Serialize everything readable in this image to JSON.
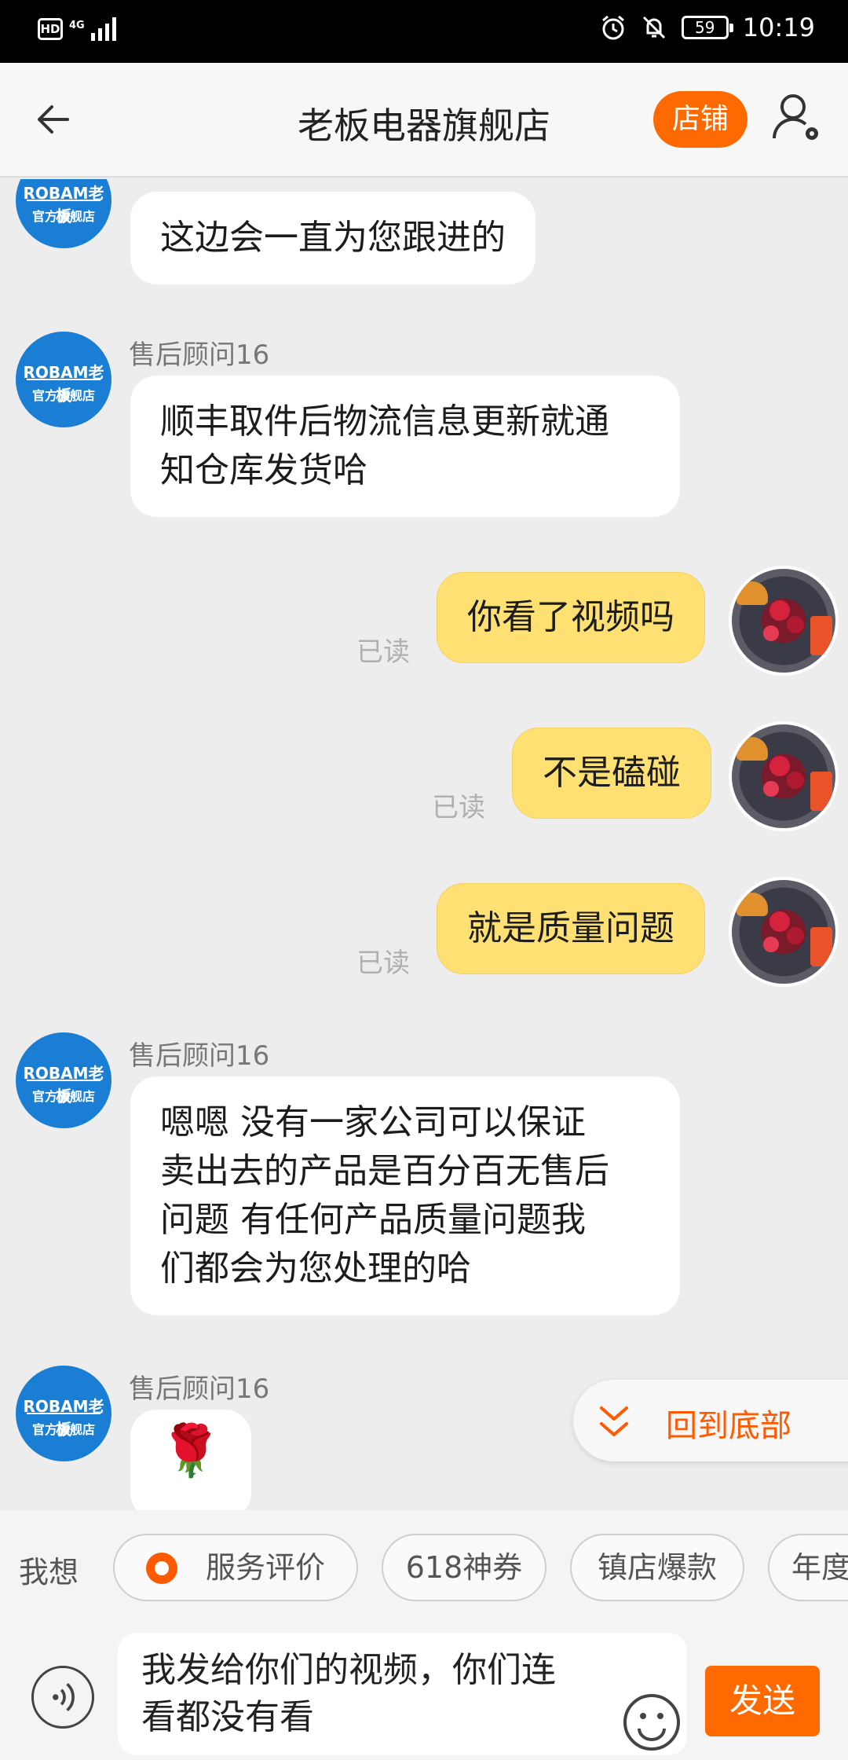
{
  "status_bar": {
    "hd": "HD",
    "network": "4G",
    "battery": "59",
    "time": "10:19"
  },
  "header": {
    "title": "老板电器旗舰店",
    "shop_button": "店铺"
  },
  "shop_avatar": {
    "brand": "ROBAM老板",
    "subtitle": "官方旗舰店"
  },
  "messages": [
    {
      "from": "shop",
      "text": "这边会一直为您跟进的"
    },
    {
      "from": "shop",
      "sender": "售后顾问16",
      "lines": [
        "顺丰取件后物流信息更新就通",
        "知仓库发货哈"
      ]
    },
    {
      "from": "user",
      "text": "你看了视频吗",
      "status": "已读"
    },
    {
      "from": "user",
      "text": "不是磕碰",
      "status": "已读"
    },
    {
      "from": "user",
      "text": "就是质量问题",
      "status": "已读"
    },
    {
      "from": "shop",
      "sender": "售后顾问16",
      "lines": [
        "嗯嗯 没有一家公司可以保证",
        "卖出去的产品是百分百无售后",
        "问题 有任何产品质量问题我",
        "们都会为您处理的哈"
      ]
    },
    {
      "from": "shop",
      "sender": "售后顾问16",
      "emoji": "🌹"
    }
  ],
  "scroll_bottom_label": "回到底部",
  "quick_replies": {
    "label": "我想",
    "chips": [
      "服务评价",
      "618神券",
      "镇店爆款",
      "年度"
    ]
  },
  "input": {
    "value_lines": [
      "我发给你们的视频，你们连",
      "看都没有看"
    ],
    "send_label": "发送"
  }
}
